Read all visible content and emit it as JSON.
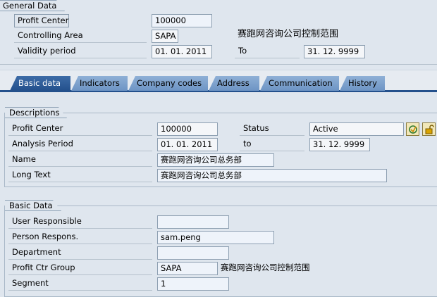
{
  "general": {
    "title": "General Data",
    "profit_center_label": "Profit Center",
    "profit_center_value": "100000",
    "controlling_area_label": "Controlling Area",
    "controlling_area_value": "SAPA",
    "controlling_area_text": "赛跑网咨询公司控制范围",
    "validity_label": "Validity period",
    "valid_from": "01. 01. 2011",
    "to_label": "To",
    "valid_to": "31. 12. 9999"
  },
  "tabs": [
    {
      "label": "Basic data",
      "active": true
    },
    {
      "label": "Indicators"
    },
    {
      "label": "Company codes"
    },
    {
      "label": "Address"
    },
    {
      "label": "Communication"
    },
    {
      "label": "History"
    }
  ],
  "descriptions": {
    "title": "Descriptions",
    "profit_center_label": "Profit Center",
    "profit_center_value": "100000",
    "status_label": "Status",
    "status_value": "Active",
    "analysis_label": "Analysis Period",
    "analysis_from": "01. 01. 2011",
    "to_label": "to",
    "analysis_to": "31. 12. 9999",
    "name_label": "Name",
    "name_value": "赛跑网咨询公司总务部",
    "long_text_label": "Long Text",
    "long_text_value": "赛跑网咨询公司总务部",
    "icons": [
      "activate-icon",
      "lock-icon"
    ]
  },
  "basic": {
    "title": "Basic Data",
    "user_label": "User Responsible",
    "user_value": "",
    "person_label": "Person Respons.",
    "person_value": "sam.peng",
    "department_label": "Department",
    "department_value": "",
    "group_label": "Profit Ctr Group",
    "group_value": "SAPA",
    "group_text": "赛跑网咨询公司控制范围",
    "segment_label": "Segment",
    "segment_value": "1"
  }
}
